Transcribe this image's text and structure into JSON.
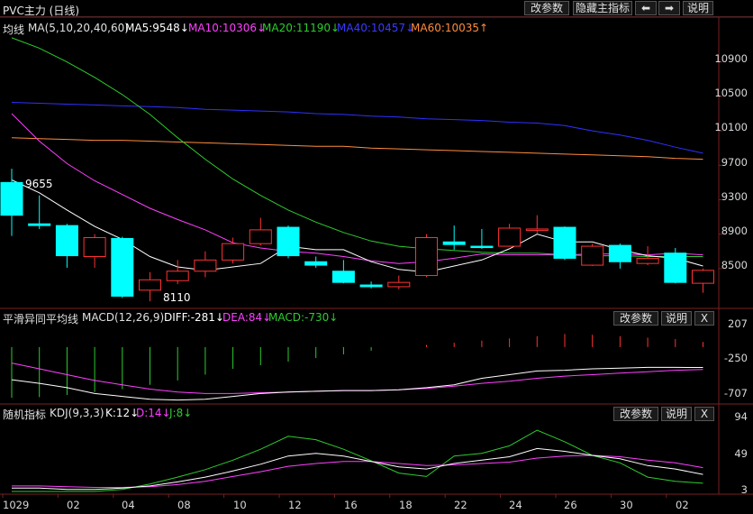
{
  "title": "PVC主力 (日线)",
  "toolbar": {
    "modify": "改参数",
    "hide_main": "隐藏主指标",
    "left_arrow": "⬅",
    "right_arrow": "➡",
    "help": "说明"
  },
  "ma_panel": {
    "name": "均线",
    "params": "MA(5,10,20,40,60)",
    "ma5": "MA5:9548↓",
    "ma10": "MA10:10306↓",
    "ma20": "MA20:11190↓",
    "ma40": "MA40:10457↓",
    "ma60": "MA60:10035↑",
    "high_mark": "9655",
    "low_mark": "8110"
  },
  "macd_panel": {
    "name": "平滑异同平均线",
    "params": "MACD(12,26,9)",
    "diff": "DIFF:-281↓",
    "dea": "DEA:84↓",
    "macd": "MACD:-730↓",
    "modify": "改参数",
    "help": "说明",
    "close": "X"
  },
  "kdj_panel": {
    "name": "随机指标",
    "params": "KDJ(9,3,3)",
    "k": "K:12↓",
    "d": "D:14↓",
    "j": "J:8↓",
    "modify": "改参数",
    "help": "说明",
    "close": "X"
  },
  "colors": {
    "up": "#ff3232",
    "down": "#00ffff",
    "ma5": "#ffffff",
    "ma10": "#ff40ff",
    "ma20": "#2ecc2e",
    "ma40": "#3030ff",
    "ma60": "#ff8c3c"
  },
  "chart_data": [
    {
      "type": "candlestick",
      "y_ticks": [
        "10900",
        "10500",
        "10100",
        "9700",
        "9300",
        "8900",
        "8500"
      ],
      "y_tick_values": [
        10900,
        10500,
        10100,
        9700,
        9300,
        8900,
        8500
      ],
      "ylim": [
        8080,
        11200
      ],
      "x_ticks": [
        "1029",
        "02",
        "04",
        "08",
        "10",
        "12",
        "16",
        "18",
        "22",
        "24",
        "26",
        "30",
        "02"
      ],
      "candles": [
        {
          "o": 9500,
          "c": 9120,
          "h": 9660,
          "l": 8880
        },
        {
          "o": 9020,
          "c": 9000,
          "h": 9350,
          "l": 8960
        },
        {
          "o": 9000,
          "c": 8650,
          "h": 9020,
          "l": 8510
        },
        {
          "o": 8640,
          "c": 8860,
          "h": 8900,
          "l": 8510
        },
        {
          "o": 8850,
          "c": 8180,
          "h": 8870,
          "l": 8160
        },
        {
          "o": 8250,
          "c": 8370,
          "h": 8460,
          "l": 8120
        },
        {
          "o": 8360,
          "c": 8470,
          "h": 8600,
          "l": 8320
        },
        {
          "o": 8470,
          "c": 8600,
          "h": 8700,
          "l": 8400
        },
        {
          "o": 8600,
          "c": 8790,
          "h": 8860,
          "l": 8560
        },
        {
          "o": 8790,
          "c": 8950,
          "h": 9090,
          "l": 8770
        },
        {
          "o": 8980,
          "c": 8650,
          "h": 9000,
          "l": 8620
        },
        {
          "o": 8580,
          "c": 8540,
          "h": 8640,
          "l": 8510
        },
        {
          "o": 8470,
          "c": 8340,
          "h": 8600,
          "l": 8330
        },
        {
          "o": 8310,
          "c": 8290,
          "h": 8350,
          "l": 8270
        },
        {
          "o": 8290,
          "c": 8340,
          "h": 8420,
          "l": 8260
        },
        {
          "o": 8420,
          "c": 8860,
          "h": 8900,
          "l": 8400
        },
        {
          "o": 8810,
          "c": 8780,
          "h": 9000,
          "l": 8720
        },
        {
          "o": 8760,
          "c": 8750,
          "h": 8960,
          "l": 8730
        },
        {
          "o": 8760,
          "c": 8970,
          "h": 9020,
          "l": 8760
        },
        {
          "o": 8960,
          "c": 8960,
          "h": 9120,
          "l": 8910
        },
        {
          "o": 8980,
          "c": 8620,
          "h": 8990,
          "l": 8600
        },
        {
          "o": 8540,
          "c": 8760,
          "h": 8790,
          "l": 8530
        },
        {
          "o": 8770,
          "c": 8580,
          "h": 8790,
          "l": 8500
        },
        {
          "o": 8560,
          "c": 8620,
          "h": 8760,
          "l": 8540
        },
        {
          "o": 8680,
          "c": 8340,
          "h": 8740,
          "l": 8330
        },
        {
          "o": 8330,
          "c": 8480,
          "h": 8500,
          "l": 8220
        }
      ],
      "ma5": [
        9530,
        9380,
        9180,
        8990,
        8840,
        8640,
        8520,
        8480,
        8520,
        8560,
        8760,
        8720,
        8720,
        8580,
        8490,
        8460,
        8530,
        8600,
        8730,
        8900,
        8810,
        8810,
        8720,
        8650,
        8620,
        8530
      ],
      "ma10": [
        10300,
        9980,
        9720,
        9520,
        9360,
        9200,
        9070,
        8950,
        8800,
        8740,
        8700,
        8680,
        8640,
        8590,
        8560,
        8580,
        8620,
        8670,
        8660,
        8660,
        8660,
        8670,
        8670,
        8660,
        8680,
        8660
      ],
      "ma20": [
        11180,
        11060,
        10900,
        10720,
        10520,
        10290,
        10020,
        9770,
        9540,
        9350,
        9180,
        9040,
        8920,
        8820,
        8760,
        8730,
        8710,
        8690,
        8680,
        8680,
        8660,
        8650,
        8650,
        8640,
        8640,
        8640
      ],
      "ma40": [
        10430,
        10420,
        10410,
        10400,
        10390,
        10380,
        10370,
        10350,
        10340,
        10330,
        10320,
        10300,
        10290,
        10270,
        10260,
        10240,
        10230,
        10220,
        10200,
        10190,
        10160,
        10100,
        10050,
        9990,
        9910,
        9840
      ],
      "ma60": [
        10020,
        10010,
        10000,
        9990,
        9990,
        9980,
        9970,
        9960,
        9950,
        9940,
        9930,
        9920,
        9920,
        9900,
        9890,
        9880,
        9870,
        9860,
        9850,
        9840,
        9830,
        9820,
        9810,
        9800,
        9780,
        9770
      ]
    },
    {
      "type": "bar",
      "name": "MACD",
      "y_ticks": [
        "207",
        "-250",
        "-707"
      ],
      "y_tick_values": [
        207,
        -250,
        -707
      ],
      "ylim": [
        -760,
        260
      ],
      "macd": [
        -700,
        -690,
        -660,
        -620,
        -580,
        -520,
        -460,
        -380,
        -300,
        -250,
        -200,
        -150,
        -100,
        -50,
        0,
        30,
        60,
        90,
        120,
        150,
        180,
        170,
        150,
        130,
        110,
        70
      ],
      "diff": [
        -450,
        -500,
        -560,
        -640,
        -680,
        -720,
        -730,
        -720,
        -680,
        -640,
        -620,
        -610,
        -600,
        -600,
        -590,
        -560,
        -520,
        -430,
        -380,
        -330,
        -320,
        -300,
        -290,
        -280,
        -280,
        -281
      ],
      "dea": [
        -220,
        -300,
        -380,
        -460,
        -520,
        -580,
        -620,
        -640,
        -640,
        -630,
        -620,
        -610,
        -600,
        -600,
        -590,
        -570,
        -540,
        -500,
        -470,
        -430,
        -400,
        -380,
        -360,
        -340,
        -320,
        -310
      ]
    },
    {
      "type": "line",
      "name": "KDJ",
      "y_ticks": [
        "94",
        "49",
        "3"
      ],
      "y_tick_values": [
        94,
        49,
        3
      ],
      "ylim": [
        -4,
        102
      ],
      "k": [
        5,
        5,
        3,
        3,
        5,
        8,
        14,
        21,
        30,
        40,
        52,
        56,
        52,
        44,
        36,
        33,
        41,
        46,
        51,
        63,
        59,
        53,
        48,
        38,
        33,
        25
      ],
      "d": [
        8,
        8,
        7,
        6,
        6,
        7,
        10,
        15,
        22,
        29,
        37,
        41,
        44,
        44,
        41,
        38,
        39,
        41,
        43,
        49,
        52,
        53,
        51,
        46,
        42,
        35
      ],
      "j": [
        0,
        0,
        0,
        0,
        3,
        11,
        21,
        32,
        46,
        62,
        81,
        76,
        62,
        45,
        27,
        22,
        52,
        56,
        67,
        90,
        73,
        53,
        42,
        21,
        15,
        12
      ]
    }
  ]
}
